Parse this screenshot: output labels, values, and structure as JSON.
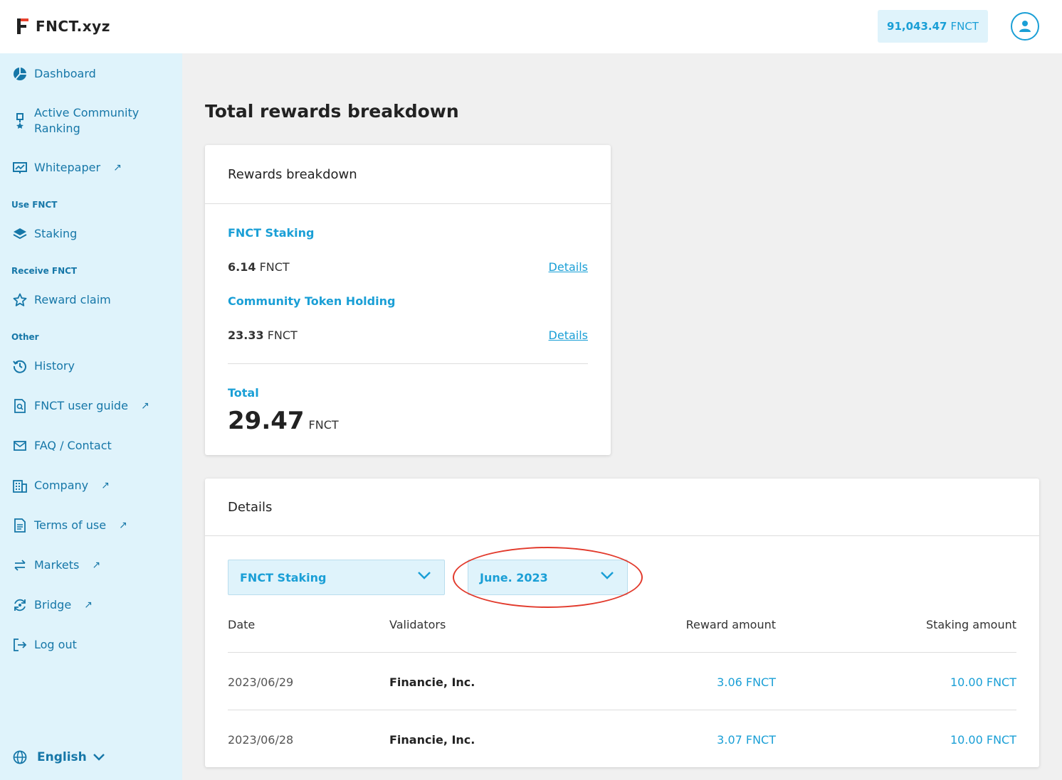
{
  "header": {
    "brand": "FNCT.xyz",
    "balance_value": "91,043.47",
    "balance_unit": "FNCT"
  },
  "sidebar": {
    "items": {
      "dashboard": "Dashboard",
      "ranking_line1": "Active Community",
      "ranking_line2": "Ranking",
      "whitepaper": "Whitepaper",
      "staking": "Staking",
      "reward_claim": "Reward claim",
      "history": "History",
      "user_guide": "FNCT user guide",
      "faq": "FAQ / Contact",
      "company": "Company",
      "terms": "Terms of use",
      "markets": "Markets",
      "bridge": "Bridge",
      "logout": "Log out"
    },
    "sections": {
      "use": "Use FNCT",
      "receive": "Receive FNCT",
      "other": "Other"
    },
    "language": "English",
    "external_arrow": "↗"
  },
  "main": {
    "title": "Total rewards breakdown",
    "breakdown": {
      "heading": "Rewards breakdown",
      "staking_label": "FNCT Staking",
      "staking_value": "6.14",
      "holding_label": "Community Token Holding",
      "holding_value": "23.33",
      "unit": "FNCT",
      "details_link": "Details",
      "total_label": "Total",
      "total_value": "29.47"
    },
    "details": {
      "heading": "Details",
      "type_select": "FNCT Staking",
      "month_select": "June. 2023",
      "columns": [
        "Date",
        "Validators",
        "Reward amount",
        "Staking amount"
      ],
      "rows": [
        {
          "date": "2023/06/29",
          "validator": "Financie, Inc.",
          "reward": "3.06 FNCT",
          "staking": "10.00 FNCT"
        },
        {
          "date": "2023/06/28",
          "validator": "Financie, Inc.",
          "reward": "3.07 FNCT",
          "staking": "10.00 FNCT"
        }
      ]
    }
  },
  "colors": {
    "accent": "#1a9fd6",
    "sidebar_bg": "#dff3fb",
    "highlight": "#e23a2c"
  }
}
